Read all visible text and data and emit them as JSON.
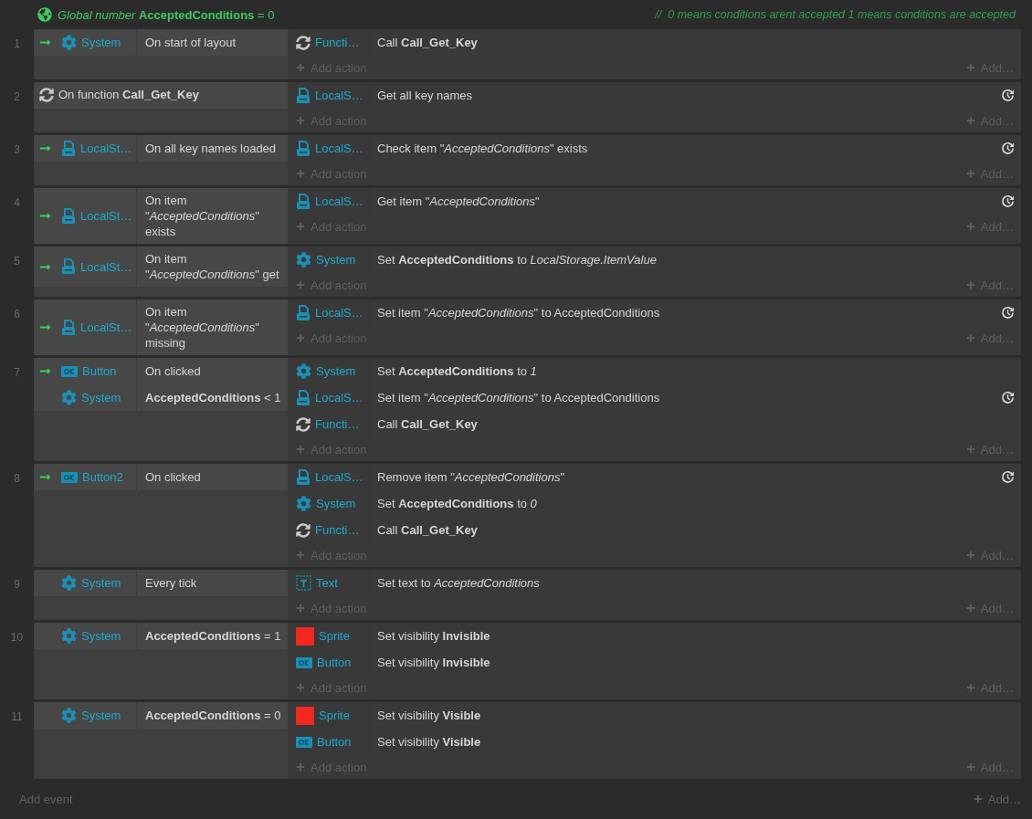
{
  "global_variable": {
    "text": "*Global number* **AcceptedConditions** = 0",
    "comment": "//  0 means conditions arent accepted 1 means conditions are accepted"
  },
  "events": [
    {
      "number": "1",
      "kind": "standard",
      "conditions": [
        {
          "trigger": true,
          "kind": "system",
          "object": "System",
          "text": "On start of layout"
        }
      ],
      "actions": [
        {
          "kind": "function",
          "object": "Functi…",
          "text": "Call **Call_Get_Key**",
          "async": false
        }
      ],
      "add_action": "Add action",
      "add_more": "Add…"
    },
    {
      "number": "2",
      "kind": "function",
      "function": {
        "text": "On function **Call_Get_Key**"
      },
      "actions": [
        {
          "kind": "storage",
          "object": "LocalS…",
          "text": "Get all key names",
          "async": true
        }
      ],
      "add_action": "Add action",
      "add_more": "Add…"
    },
    {
      "number": "3",
      "kind": "standard",
      "conditions": [
        {
          "trigger": true,
          "kind": "storage",
          "object": "LocalSt…",
          "text": "On all key names loaded"
        }
      ],
      "actions": [
        {
          "kind": "storage",
          "object": "LocalS…",
          "text": "Check item \"*AcceptedConditions*\" exists",
          "async": true
        }
      ],
      "add_action": "Add action",
      "add_more": "Add…"
    },
    {
      "number": "4",
      "kind": "standard",
      "conditions": [
        {
          "trigger": true,
          "kind": "storage",
          "object": "LocalSt…",
          "text": "On item \"*AcceptedConditions*\" exists"
        }
      ],
      "actions": [
        {
          "kind": "storage",
          "object": "LocalS…",
          "text": "Get item \"*AcceptedConditions*\"",
          "async": true
        }
      ],
      "add_action": "Add action",
      "add_more": "Add…"
    },
    {
      "number": "5",
      "kind": "standard",
      "conditions": [
        {
          "trigger": true,
          "kind": "storage",
          "object": "LocalSt…",
          "text": "On item \"*AcceptedConditions*\" get"
        }
      ],
      "actions": [
        {
          "kind": "system",
          "object": "System",
          "text": "Set **AcceptedConditions** to *LocalStorage.ItemValue*",
          "async": false
        }
      ],
      "add_action": "Add action",
      "add_more": "Add…"
    },
    {
      "number": "6",
      "kind": "standard",
      "conditions": [
        {
          "trigger": true,
          "kind": "storage",
          "object": "LocalSt…",
          "text": "On item \"*AcceptedConditions*\" missing"
        }
      ],
      "actions": [
        {
          "kind": "storage",
          "object": "LocalS…",
          "text": "Set item \"*AcceptedConditions*\" to AcceptedConditions",
          "async": true
        }
      ],
      "add_action": "Add action",
      "add_more": "Add…"
    },
    {
      "number": "7",
      "kind": "standard",
      "conditions": [
        {
          "trigger": true,
          "kind": "button",
          "object": "Button",
          "text": "On clicked"
        },
        {
          "trigger": false,
          "kind": "system",
          "object": "System",
          "text": "**AcceptedConditions** < 1"
        }
      ],
      "actions": [
        {
          "kind": "system",
          "object": "System",
          "text": "Set **AcceptedConditions** to *1*",
          "async": false
        },
        {
          "kind": "storage",
          "object": "LocalS…",
          "text": "Set item \"*AcceptedConditions*\" to AcceptedConditions",
          "async": true
        },
        {
          "kind": "function",
          "object": "Functi…",
          "text": "Call **Call_Get_Key**",
          "async": false
        }
      ],
      "add_action": "Add action",
      "add_more": "Add…"
    },
    {
      "number": "8",
      "kind": "standard",
      "conditions": [
        {
          "trigger": true,
          "kind": "button",
          "object": "Button2",
          "text": "On clicked"
        }
      ],
      "actions": [
        {
          "kind": "storage",
          "object": "LocalS…",
          "text": "Remove item \"*AcceptedConditions*\"",
          "async": true
        },
        {
          "kind": "system",
          "object": "System",
          "text": "Set **AcceptedConditions** to *0*",
          "async": false
        },
        {
          "kind": "function",
          "object": "Functi…",
          "text": "Call **Call_Get_Key**",
          "async": false
        }
      ],
      "add_action": "Add action",
      "add_more": "Add…"
    },
    {
      "number": "9",
      "kind": "standard",
      "conditions": [
        {
          "trigger": false,
          "kind": "system",
          "object": "System",
          "text": "Every tick"
        }
      ],
      "actions": [
        {
          "kind": "text",
          "object": "Text",
          "text": "Set text to *AcceptedConditions*",
          "async": false
        }
      ],
      "add_action": "Add action",
      "add_more": "Add…"
    },
    {
      "number": "10",
      "kind": "standard",
      "conditions": [
        {
          "trigger": false,
          "kind": "system",
          "object": "System",
          "text": "**AcceptedConditions** = 1"
        }
      ],
      "actions": [
        {
          "kind": "sprite",
          "object": "Sprite",
          "text": "Set visibility **Invisible**",
          "async": false
        },
        {
          "kind": "button",
          "object": "Button",
          "text": "Set visibility **Invisible**",
          "async": false
        }
      ],
      "add_action": "Add action",
      "add_more": "Add…"
    },
    {
      "number": "11",
      "kind": "standard",
      "conditions": [
        {
          "trigger": false,
          "kind": "system",
          "object": "System",
          "text": "**AcceptedConditions** = 0"
        }
      ],
      "actions": [
        {
          "kind": "sprite",
          "object": "Sprite",
          "text": "Set visibility **Visible**",
          "async": false
        },
        {
          "kind": "button",
          "object": "Button",
          "text": "Set visibility **Visible**",
          "async": false
        }
      ],
      "add_action": "Add action",
      "add_more": "Add…"
    }
  ],
  "footer": {
    "add_event": "Add event",
    "add_more": "Add…"
  }
}
